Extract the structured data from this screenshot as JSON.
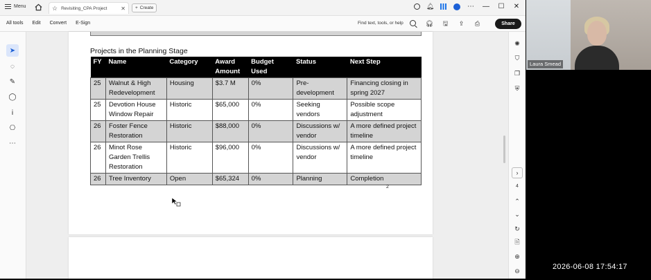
{
  "titlebar": {
    "menu_label": "Menu",
    "tab_title": "Revisiting_CPA Project",
    "create_label": "Create"
  },
  "toolbar": {
    "tabs": [
      "All tools",
      "Edit",
      "Convert",
      "E-Sign"
    ],
    "find_placeholder": "Find text, tools, or help",
    "share_label": "Share"
  },
  "document": {
    "section_title": "Projects in the Planning Stage",
    "columns": [
      "FY",
      "Name",
      "Category",
      "Award Amount",
      "Budget Used",
      "Status",
      "Next Step"
    ],
    "rows": [
      {
        "fy": "25",
        "name": "Walnut & High Redevelopment",
        "category": "Housing",
        "award": "$3.7 M",
        "budget": "0%",
        "status": "Pre-development",
        "next": "Financing closing in spring 2027",
        "shaded": true
      },
      {
        "fy": "25",
        "name": "Devotion House Window Repair",
        "category": "Historic",
        "award": "$65,000",
        "budget": "0%",
        "status": "Seeking vendors",
        "next": "Possible scope adjustment",
        "shaded": false
      },
      {
        "fy": "26",
        "name": "Foster Fence Restoration",
        "category": "Historic",
        "award": "$88,000",
        "budget": "0%",
        "status": "Discussions w/ vendor",
        "next": "A more defined project timeline",
        "shaded": true
      },
      {
        "fy": "26",
        "name": "Minot Rose Garden Trellis Restoration",
        "category": "Historic",
        "award": "$96,000",
        "budget": "0%",
        "status": "Discussions w/ vendor",
        "next": "A more defined project timeline",
        "shaded": false
      },
      {
        "fy": "26",
        "name": "Tree Inventory",
        "category": "Open",
        "award": "$65,324",
        "budget": "0%",
        "status": "Planning",
        "next": "Completion",
        "shaded": true
      }
    ],
    "page_number": "2"
  },
  "right_rail": {
    "page_indicator": "4"
  },
  "webcam": {
    "participant_name": "Laura Smead"
  },
  "overlay": {
    "timestamp": "2026-06-08 17:54:17"
  },
  "icons": {
    "titlebar": [
      "menu-icon",
      "home-icon",
      "star-icon",
      "close-tab-icon",
      "plus-icon",
      "help-icon",
      "bell-icon",
      "apps-grid-icon",
      "account-icon",
      "more-icon",
      "minimize-icon",
      "maximize-icon",
      "close-window-icon"
    ],
    "left_tools": [
      "select-arrow-icon",
      "comment-icon",
      "highlight-pen-icon",
      "lasso-icon",
      "text-select-icon",
      "stamp-icon",
      "more-tools-icon"
    ],
    "right_tools": [
      "ai-assistant-icon",
      "bookmark-icon",
      "copy-pages-icon",
      "protect-icon",
      "expand-icon",
      "scroll-up-icon",
      "scroll-down-icon",
      "refresh-icon",
      "save-page-icon",
      "zoom-in-icon",
      "zoom-out-icon"
    ]
  },
  "colors": {
    "header_bg": "#000000",
    "shaded_row": "#d4d4d4",
    "share_button": "#1a1a1a",
    "selected_tool": "#dbe6fb"
  }
}
